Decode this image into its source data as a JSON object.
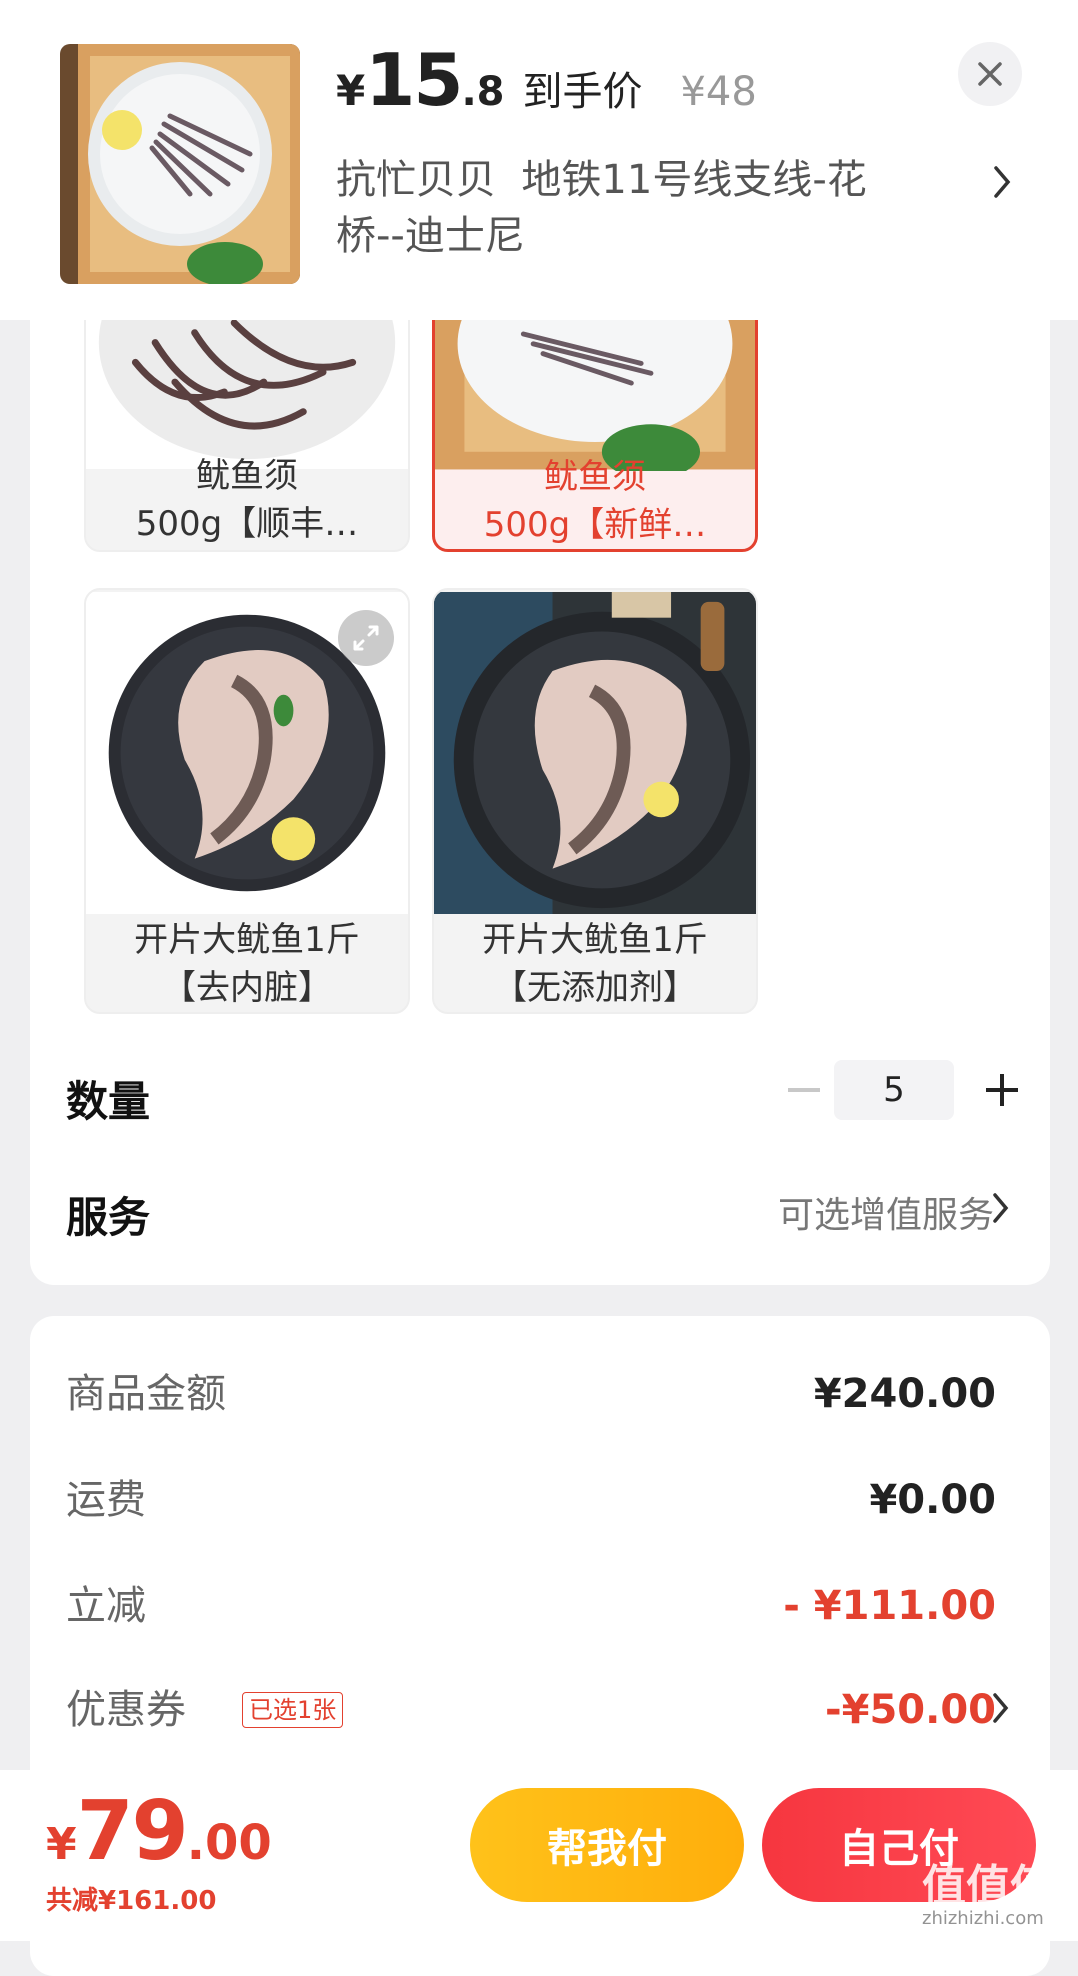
{
  "header": {
    "price_symbol": "¥",
    "price_int": "15",
    "price_dec": ".8",
    "price_label": "到手价",
    "original_price": "¥48",
    "address": "抗忙贝贝  地铁11号线支线-花桥--迪士尼",
    "close_icon": "close-icon",
    "chevron_icon": "chevron-right-icon"
  },
  "variants": [
    {
      "line1": "鱿鱼须",
      "line2": "500g【顺丰…",
      "selected": false
    },
    {
      "line1": "鱿鱼须",
      "line2": "500g【新鲜…",
      "selected": true
    },
    {
      "line1": "开片大鱿鱼1斤",
      "line2": "【去内脏】",
      "selected": false
    },
    {
      "line1": "开片大鱿鱼1斤",
      "line2": "【无添加剂】",
      "selected": false
    }
  ],
  "quantity": {
    "label": "数量",
    "value": "5"
  },
  "service": {
    "label": "服务",
    "value": "可选增值服务"
  },
  "summary": {
    "goods_label": "商品金额",
    "goods_value": "¥240.00",
    "shipping_label": "运费",
    "shipping_value": "¥0.00",
    "discount_label": "立减",
    "discount_value": "- ¥111.00",
    "coupon_label": "优惠券",
    "coupon_tag": "已选1张",
    "coupon_value": "-¥50.00"
  },
  "footer": {
    "total_symbol": "¥",
    "total_int": "79",
    "total_dec": ".00",
    "saved": "共减¥161.00",
    "help_pay": "帮我付",
    "self_pay": "自己付"
  },
  "watermark": {
    "text": "值值值",
    "sub": "zhizhizhi.com"
  },
  "colors": {
    "accent_red": "#e3412f",
    "help_btn": "#ffb812",
    "self_btn": "#f63d47"
  }
}
